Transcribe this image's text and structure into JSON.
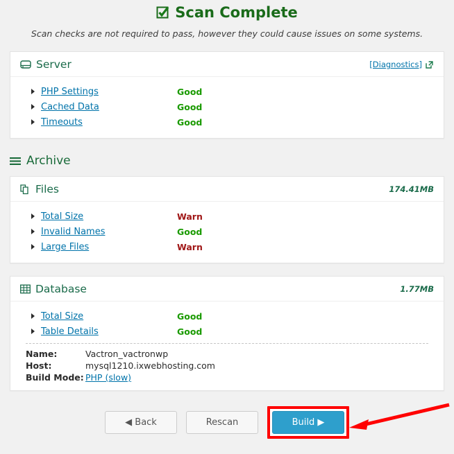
{
  "header": {
    "icon": "checked-checkbox-icon",
    "title": "Scan Complete",
    "subtitle": "Scan checks are not required to pass, however they could cause issues on some systems."
  },
  "server_panel": {
    "icon": "hard-drive-icon",
    "title": "Server",
    "diagnostics_label": "[Diagnostics]",
    "diagnostics_icon": "external-link-icon",
    "checks": [
      {
        "label": "PHP Settings",
        "status": "Good",
        "state": "good"
      },
      {
        "label": "Cached Data",
        "status": "Good",
        "state": "good"
      },
      {
        "label": "Timeouts",
        "status": "Good",
        "state": "good"
      }
    ]
  },
  "archive_section": {
    "icon": "hamburger-icon",
    "title": "Archive"
  },
  "files_panel": {
    "icon": "files-copy-icon",
    "title": "Files",
    "size": "174.41MB",
    "checks": [
      {
        "label": "Total Size",
        "status": "Warn",
        "state": "warn"
      },
      {
        "label": "Invalid Names",
        "status": "Good",
        "state": "good"
      },
      {
        "label": "Large Files",
        "status": "Warn",
        "state": "warn"
      }
    ]
  },
  "database_panel": {
    "icon": "table-grid-icon",
    "title": "Database",
    "size": "1.77MB",
    "checks": [
      {
        "label": "Total Size",
        "status": "Good",
        "state": "good"
      },
      {
        "label": "Table Details",
        "status": "Good",
        "state": "good"
      }
    ],
    "details": [
      {
        "key": "Name:",
        "value": "Vactron_vactronwp",
        "link": false
      },
      {
        "key": "Host:",
        "value": "mysql1210.ixwebhosting.com",
        "link": false
      },
      {
        "key": "Build Mode:",
        "value": "PHP (slow)",
        "link": true
      }
    ]
  },
  "footer": {
    "back_label": "◀ Back",
    "rescan_label": "Rescan",
    "build_label": "Build ▶"
  },
  "colors": {
    "good": "#1a9a00",
    "warn": "#a01717",
    "link": "#0073aa",
    "green_heading": "#1a6b4a",
    "primary_button": "#2e9fcc",
    "annotation_red": "#ff0000",
    "page_background": "#f1f1f1"
  }
}
